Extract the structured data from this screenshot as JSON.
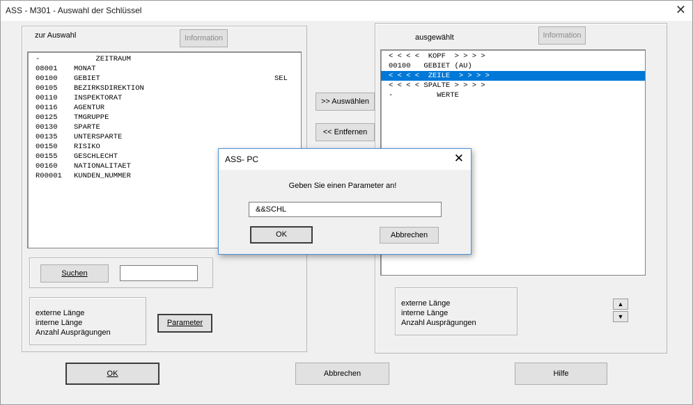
{
  "window": {
    "title": "ASS - M301 - Auswahl der Schlüssel"
  },
  "left_panel": {
    "heading": "zur Auswahl",
    "info_button": "Information",
    "items": [
      {
        "code": "-",
        "name": "     ZEITRAUM",
        "flag": ""
      },
      {
        "code": "08001",
        "name": "MONAT",
        "flag": ""
      },
      {
        "code": "00100",
        "name": "GEBIET",
        "flag": "SEL"
      },
      {
        "code": "00105",
        "name": "BEZIRKSDIREKTION",
        "flag": ""
      },
      {
        "code": "00110",
        "name": "INSPEKTORAT",
        "flag": ""
      },
      {
        "code": "00116",
        "name": "AGENTUR",
        "flag": ""
      },
      {
        "code": "00125",
        "name": "TMGRUPPE",
        "flag": ""
      },
      {
        "code": "00130",
        "name": "SPARTE",
        "flag": ""
      },
      {
        "code": "00135",
        "name": "UNTERSPARTE",
        "flag": ""
      },
      {
        "code": "00150",
        "name": "RISIKO",
        "flag": ""
      },
      {
        "code": "00155",
        "name": "GESCHLECHT",
        "flag": ""
      },
      {
        "code": "00160",
        "name": "NATIONALITAET",
        "flag": ""
      },
      {
        "code": "R00001",
        "name": "KUNDEN_NUMMER",
        "flag": ""
      }
    ],
    "search_button": "Suchen",
    "search_value": "",
    "info_lines": [
      "externe Länge",
      "interne Länge",
      "Anzahl Ausprägungen"
    ],
    "parameter_button": "Parameter"
  },
  "middle": {
    "select_button": ">> Auswählen",
    "remove_button": "<< Entfernen"
  },
  "right_panel": {
    "heading": "ausgewählt",
    "info_button": "Information",
    "items": [
      {
        "text": "< < < <  KOPF  > > > >",
        "selected": false
      },
      {
        "text": "00100   GEBIET (AU)",
        "selected": false
      },
      {
        "text": "< < < <  ZEILE  > > > >",
        "selected": true
      },
      {
        "text": "< < < < SPALTE > > > >",
        "selected": false
      },
      {
        "text": "-          WERTE",
        "selected": false
      }
    ],
    "info_lines": [
      "externe Länge",
      "interne Länge",
      "Anzahl Ausprägungen"
    ]
  },
  "footer": {
    "ok": "OK",
    "cancel": "Abbrechen",
    "help": "Hilfe"
  },
  "dialog": {
    "title": "ASS- PC",
    "prompt": "Geben Sie einen Parameter an!",
    "value": "&&SCHL",
    "ok": "OK",
    "cancel": "Abbrechen"
  }
}
